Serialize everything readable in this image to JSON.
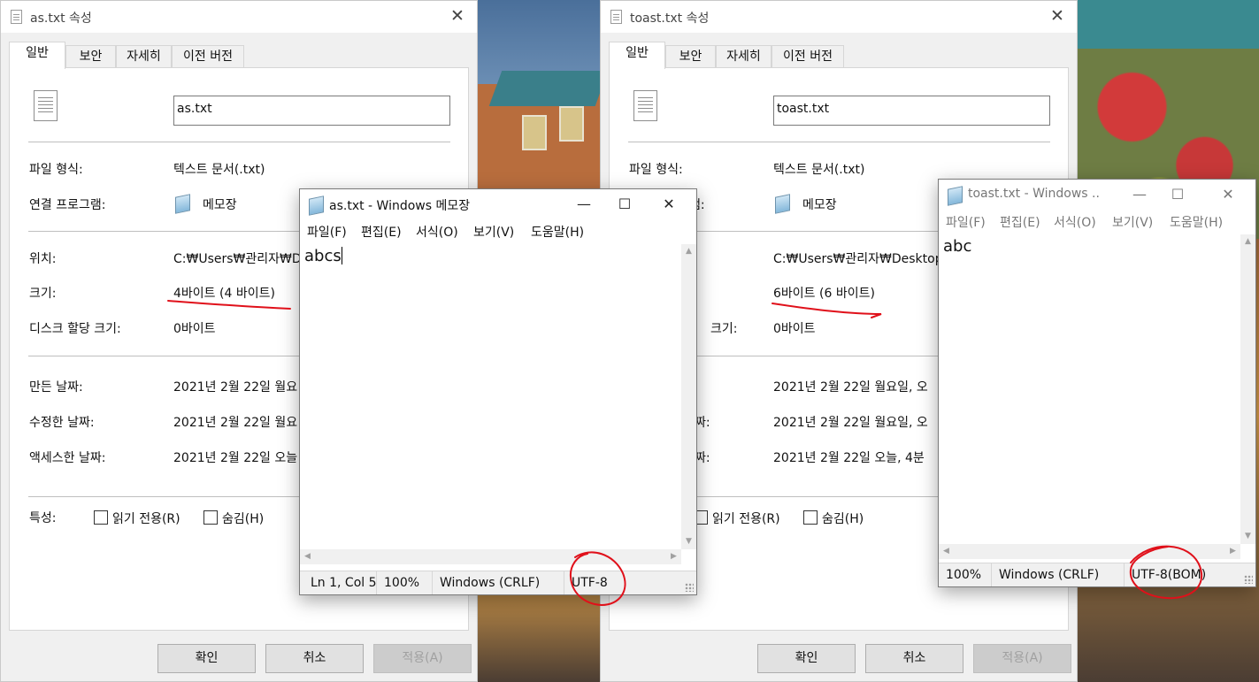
{
  "colors": {
    "annotation_red": "#e0101a",
    "dialog_bg": "#f0f0f0",
    "panel_bg": "#ffffff",
    "disabled_text": "#a0a0a0"
  },
  "props_left": {
    "title": "as.txt 속성",
    "tabs": [
      "일반",
      "보안",
      "자세히",
      "이전 버전"
    ],
    "filename": "as.txt",
    "rows": {
      "type_label": "파일 형식:",
      "type_value": "텍스트 문서(.txt)",
      "opens_label": "연결 프로그램:",
      "opens_value": "메모장",
      "location_label": "위치:",
      "location_value": "C:₩Users₩관리자₩Des",
      "size_label": "크기:",
      "size_value": "4바이트 (4 바이트)",
      "disk_label": "디스크 할당 크기:",
      "disk_value": "0바이트",
      "created_label": "만든 날짜:",
      "created_value": "2021년 2월 22일 월요",
      "modified_label": "수정한 날짜:",
      "modified_value": "2021년 2월 22일 월요",
      "accessed_label": "액세스한 날짜:",
      "accessed_value": "2021년 2월 22일 오늘",
      "attr_label": "특성:",
      "readonly_label": "읽기 전용(R)",
      "hidden_label": "숨김(H)"
    },
    "buttons": {
      "ok": "확인",
      "cancel": "취소",
      "apply": "적용(A)"
    }
  },
  "props_right": {
    "title": "toast.txt 속성",
    "tabs": [
      "일반",
      "보안",
      "자세히",
      "이전 버전"
    ],
    "filename": "toast.txt",
    "rows": {
      "type_label": "파일 형식:",
      "type_value": "텍스트 문서(.txt)",
      "opens_label": "램:",
      "opens_value": "메모장",
      "location_value": "C:₩Users₩관리자₩Desktop",
      "size_value": "6바이트 (6 바이트)",
      "disk_label": "크기:",
      "disk_value": "0바이트",
      "created_value": "2021년 2월 22일 월요일, 오",
      "modified_label": "짜:",
      "modified_value": "2021년 2월 22일 월요일, 오",
      "accessed_label": "짜:",
      "accessed_value": "2021년 2월 22일 오늘, 4분 ",
      "readonly_label": "읽기 전용(R)",
      "hidden_label": "숨김(H)"
    },
    "buttons": {
      "ok": "확인",
      "cancel": "취소",
      "apply": "적용(A)"
    }
  },
  "notepad_left": {
    "title": "as.txt - Windows 메모장",
    "menu": [
      "파일(F)",
      "편집(E)",
      "서식(O)",
      "보기(V)",
      "도움말(H)"
    ],
    "content": "abcs",
    "status": {
      "position": "Ln 1, Col 5",
      "zoom": "100%",
      "line_ending": "Windows (CRLF)",
      "encoding": "UTF-8"
    }
  },
  "notepad_right": {
    "title": "toast.txt - Windows ...",
    "menu": [
      "파일(F)",
      "편집(E)",
      "서식(O)",
      "보기(V)",
      "도움말(H)"
    ],
    "content": "abc",
    "status": {
      "zoom": "100%",
      "line_ending": "Windows (CRLF)",
      "encoding": "UTF-8(BOM)"
    }
  },
  "window_glyphs": {
    "minimize": "—",
    "maximize": "☐",
    "close": "✕"
  }
}
